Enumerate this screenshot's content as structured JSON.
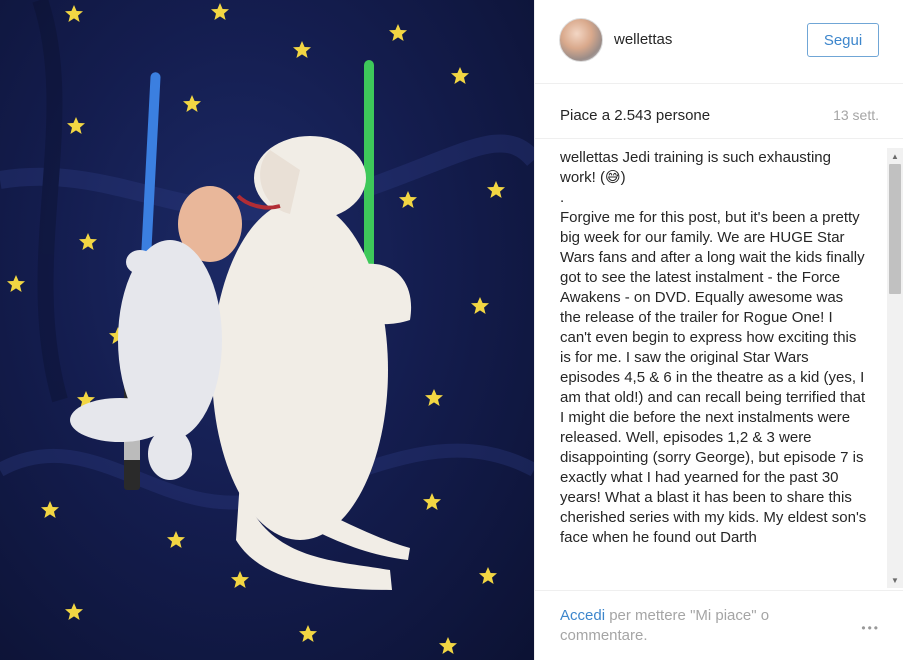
{
  "post": {
    "username": "wellettas",
    "follow_label": "Segui",
    "likes_text": "Piace a 2.543 persone",
    "time_text": "13 sett.",
    "caption_author": "wellettas",
    "caption_text": " Jedi training is such exhausting work! (😅)\n.\nForgive me for this post, but it's been a pretty big week for our family. We are HUGE Star Wars fans and after a long wait the kids finally got to see the latest instalment - the Force Awakens - on DVD. Equally awesome was the release of the trailer for Rogue One! I can't even begin to express how exciting this is for me. I saw the original Star Wars episodes 4,5 & 6 in the theatre as a kid (yes, I am that old!) and can recall being terrified that I might die before the next instalments were released. Well, episodes 1,2 & 3 were disappointing (sorry George), but episode 7 is exactly what I had yearned for the past 30 years! What a blast it has been to share this cherished series with my kids. My eldest son's face when he found out Darth",
    "login_link": "Accedi",
    "login_suffix": " per mettere \"Mi piace\" o commentare.",
    "more_icon": "•••"
  },
  "icons": {
    "scroll_up": "▲",
    "scroll_down": "▼"
  },
  "colors": {
    "accent": "#3d86cc",
    "muted": "#a5a5a5",
    "photo_background": "#141d4f",
    "star": "#f2d643",
    "blue_saber": "#3b7fe0",
    "green_saber": "#3ec85a"
  }
}
